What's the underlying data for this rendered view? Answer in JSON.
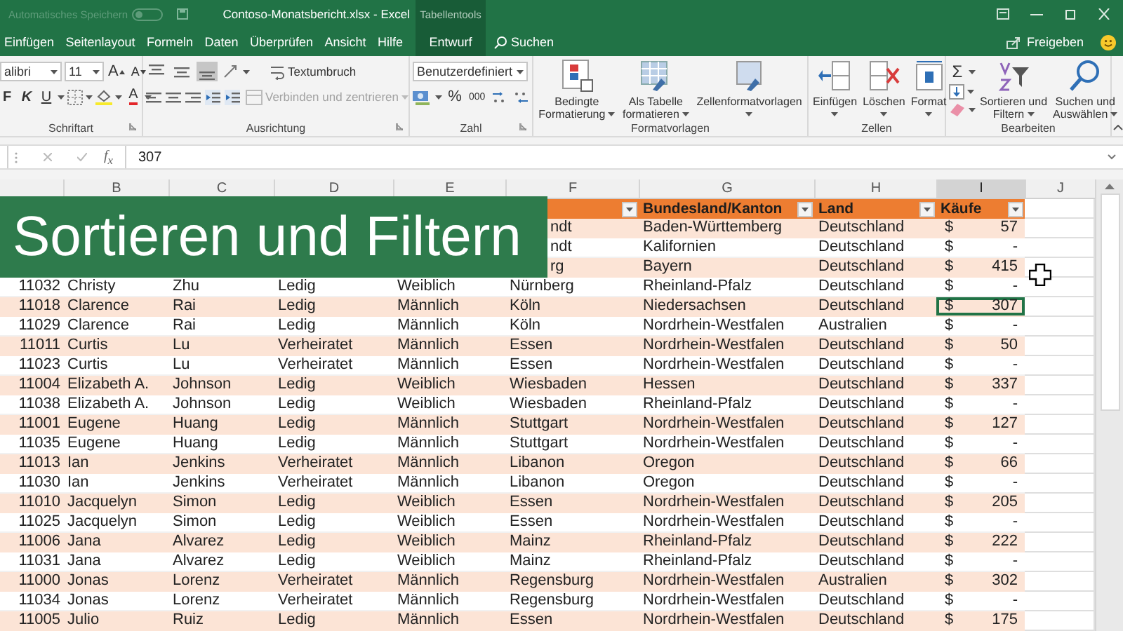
{
  "title_bar": {
    "autosave_label": "Automatisches Speichern",
    "autosave_on": false,
    "title": "Contoso-Monatsbericht.xlsx - Excel",
    "context_label": "Tabellentools"
  },
  "tabs": [
    {
      "label": "Einfügen",
      "selected": false,
      "kind": "standard"
    },
    {
      "label": "Seitenlayout",
      "selected": false,
      "kind": "standard"
    },
    {
      "label": "Formeln",
      "selected": false,
      "kind": "standard"
    },
    {
      "label": "Daten",
      "selected": false,
      "kind": "standard"
    },
    {
      "label": "Überprüfen",
      "selected": false,
      "kind": "standard"
    },
    {
      "label": "Ansicht",
      "selected": false,
      "kind": "standard"
    },
    {
      "label": "Hilfe",
      "selected": false,
      "kind": "standard"
    },
    {
      "label": "Entwurf",
      "selected": false,
      "kind": "context"
    }
  ],
  "search": {
    "label": "Suchen"
  },
  "share": {
    "label": "Freigeben"
  },
  "ribbon": {
    "groups": [
      {
        "kind": "font",
        "label": "Schriftart",
        "font_name": "alibri",
        "font_size": "11",
        "grow_letter": "A",
        "shrink_letter": "A",
        "bold": "F",
        "italic": "K",
        "underline": "U",
        "color_letter": "A"
      },
      {
        "kind": "alignment",
        "label": "Ausrichtung",
        "vertical_align": [
          {
            "selected": false
          },
          {
            "selected": false
          },
          {
            "selected": true
          }
        ],
        "wrap_text": "Textumbruch",
        "merge": {
          "label": "Verbinden und zentrieren",
          "disabled": true
        }
      },
      {
        "kind": "number",
        "label": "Zahl",
        "format": "Benutzerdefiniert",
        "percent": "%",
        "thousands": "000"
      },
      {
        "kind": "styles",
        "label": "Formatvorlagen",
        "buttons": [
          {
            "lines": [
              "Bedingte",
              "Formatierung"
            ]
          },
          {
            "lines": [
              "Als Tabelle",
              "formatieren"
            ]
          },
          {
            "lines": [
              "Zellenformatvorlagen"
            ]
          }
        ]
      },
      {
        "kind": "cells",
        "label": "Zellen",
        "buttons": [
          {
            "lines": [
              "Einfügen"
            ]
          },
          {
            "lines": [
              "Löschen"
            ]
          },
          {
            "lines": [
              "Format"
            ]
          }
        ]
      },
      {
        "kind": "editing",
        "label": "Bearbeiten",
        "sum": "Σ",
        "buttons": [
          {
            "lines": [
              "Sortieren und",
              "Filtern"
            ]
          },
          {
            "lines": [
              "Suchen und",
              "Auswählen"
            ]
          }
        ]
      }
    ]
  },
  "formula_bar": {
    "fx": "f$_{x}$",
    "value": "307"
  },
  "sheet": {
    "columns": [
      {
        "label": "B",
        "selected": false
      },
      {
        "label": "C",
        "selected": false
      },
      {
        "label": "D",
        "selected": false
      },
      {
        "label": "E",
        "selected": false
      },
      {
        "label": "F",
        "selected": false
      },
      {
        "label": "G",
        "selected": false
      },
      {
        "label": "H",
        "selected": false
      },
      {
        "label": "I",
        "selected": true
      },
      {
        "label": "J",
        "selected": false
      }
    ],
    "table_headers": [
      {
        "label": "Bundesland/Kanton"
      },
      {
        "label": "Land"
      },
      {
        "label": "Käufe"
      }
    ],
    "rows": [
      {
        "covered": true,
        "city": "ndt",
        "state": "Baden-Württemberg",
        "country": "Deutschland",
        "currency": "$",
        "amount": "57",
        "selected": false
      },
      {
        "covered": true,
        "city": "ndt",
        "state": "Kalifornien",
        "country": "Deutschland",
        "currency": "$",
        "amount": "-",
        "selected": false
      },
      {
        "covered": true,
        "city": "rg",
        "state": "Bayern",
        "country": "Deutschland",
        "currency": "$",
        "amount": "415",
        "selected": false
      },
      {
        "id": "11032",
        "first_name": "Christy",
        "last_name": "Zhu",
        "status": "Ledig",
        "gender": "Weiblich",
        "city": "Nürnberg",
        "state": "Rheinland-Pfalz",
        "country": "Deutschland",
        "currency": "$",
        "amount": "-",
        "selected": false
      },
      {
        "id": "11018",
        "first_name": "Clarence",
        "last_name": "Rai",
        "status": "Ledig",
        "gender": "Männlich",
        "city": "Köln",
        "state": "Niedersachsen",
        "country": "Deutschland",
        "currency": "$",
        "amount": "307",
        "selected": true
      },
      {
        "id": "11029",
        "first_name": "Clarence",
        "last_name": "Rai",
        "status": "Ledig",
        "gender": "Männlich",
        "city": "Köln",
        "state": "Nordrhein-Westfalen",
        "country": "Australien",
        "currency": "$",
        "amount": "-",
        "selected": false
      },
      {
        "id": "11011",
        "first_name": "Curtis",
        "last_name": "Lu",
        "status": "Verheiratet",
        "gender": "Männlich",
        "city": "Essen",
        "state": "Nordrhein-Westfalen",
        "country": "Deutschland",
        "currency": "$",
        "amount": "50",
        "selected": false
      },
      {
        "id": "11023",
        "first_name": "Curtis",
        "last_name": "Lu",
        "status": "Verheiratet",
        "gender": "Männlich",
        "city": "Essen",
        "state": "Nordrhein-Westfalen",
        "country": "Deutschland",
        "currency": "$",
        "amount": "-",
        "selected": false
      },
      {
        "id": "11004",
        "first_name": "Elizabeth A.",
        "last_name": "Johnson",
        "status": "Ledig",
        "gender": "Weiblich",
        "city": "Wiesbaden",
        "state": "Hessen",
        "country": "Deutschland",
        "currency": "$",
        "amount": "337",
        "selected": false
      },
      {
        "id": "11038",
        "first_name": "Elizabeth A.",
        "last_name": "Johnson",
        "status": "Ledig",
        "gender": "Weiblich",
        "city": "Wiesbaden",
        "state": "Rheinland-Pfalz",
        "country": "Deutschland",
        "currency": "$",
        "amount": "-",
        "selected": false
      },
      {
        "id": "11001",
        "first_name": "Eugene",
        "last_name": "Huang",
        "status": "Ledig",
        "gender": "Männlich",
        "city": "Stuttgart",
        "state": "Nordrhein-Westfalen",
        "country": "Deutschland",
        "currency": "$",
        "amount": "127",
        "selected": false
      },
      {
        "id": "11035",
        "first_name": "Eugene",
        "last_name": "Huang",
        "status": "Ledig",
        "gender": "Männlich",
        "city": "Stuttgart",
        "state": "Nordrhein-Westfalen",
        "country": "Deutschland",
        "currency": "$",
        "amount": "-",
        "selected": false
      },
      {
        "id": "11013",
        "first_name": "Ian",
        "last_name": "Jenkins",
        "status": "Verheiratet",
        "gender": "Männlich",
        "city": "Libanon",
        "state": "Oregon",
        "country": "Deutschland",
        "currency": "$",
        "amount": "66",
        "selected": false
      },
      {
        "id": "11030",
        "first_name": "Ian",
        "last_name": "Jenkins",
        "status": "Verheiratet",
        "gender": "Männlich",
        "city": "Libanon",
        "state": "Oregon",
        "country": "Deutschland",
        "currency": "$",
        "amount": "-",
        "selected": false
      },
      {
        "id": "11010",
        "first_name": "Jacquelyn",
        "last_name": "Simon",
        "status": "Ledig",
        "gender": "Weiblich",
        "city": "Essen",
        "state": "Nordrhein-Westfalen",
        "country": "Deutschland",
        "currency": "$",
        "amount": "205",
        "selected": false
      },
      {
        "id": "11025",
        "first_name": "Jacquelyn",
        "last_name": "Simon",
        "status": "Ledig",
        "gender": "Weiblich",
        "city": "Essen",
        "state": "Nordrhein-Westfalen",
        "country": "Deutschland",
        "currency": "$",
        "amount": "-",
        "selected": false
      },
      {
        "id": "11006",
        "first_name": "Jana",
        "last_name": "Alvarez",
        "status": "Ledig",
        "gender": "Weiblich",
        "city": "Mainz",
        "state": "Rheinland-Pfalz",
        "country": "Deutschland",
        "currency": "$",
        "amount": "222",
        "selected": false
      },
      {
        "id": "11031",
        "first_name": "Jana",
        "last_name": "Alvarez",
        "status": "Ledig",
        "gender": "Weiblich",
        "city": "Mainz",
        "state": "Rheinland-Pfalz",
        "country": "Deutschland",
        "currency": "$",
        "amount": "-",
        "selected": false
      },
      {
        "id": "11000",
        "first_name": "Jonas",
        "last_name": "Lorenz",
        "status": "Verheiratet",
        "gender": "Männlich",
        "city": "Regensburg",
        "state": "Nordrhein-Westfalen",
        "country": "Australien",
        "currency": "$",
        "amount": "302",
        "selected": false
      },
      {
        "id": "11034",
        "first_name": "Jonas",
        "last_name": "Lorenz",
        "status": "Verheiratet",
        "gender": "Männlich",
        "city": "Regensburg",
        "state": "Nordrhein-Westfalen",
        "country": "Deutschland",
        "currency": "$",
        "amount": "-",
        "selected": false
      },
      {
        "id": "11005",
        "first_name": "Julio",
        "last_name": "Ruiz",
        "status": "Ledig",
        "gender": "Männlich",
        "city": "Essen",
        "state": "Nordrhein-Westfalen",
        "country": "Deutschland",
        "currency": "$",
        "amount": "175",
        "selected": false
      }
    ]
  },
  "banner": {
    "text": "Sortieren und Filtern"
  }
}
